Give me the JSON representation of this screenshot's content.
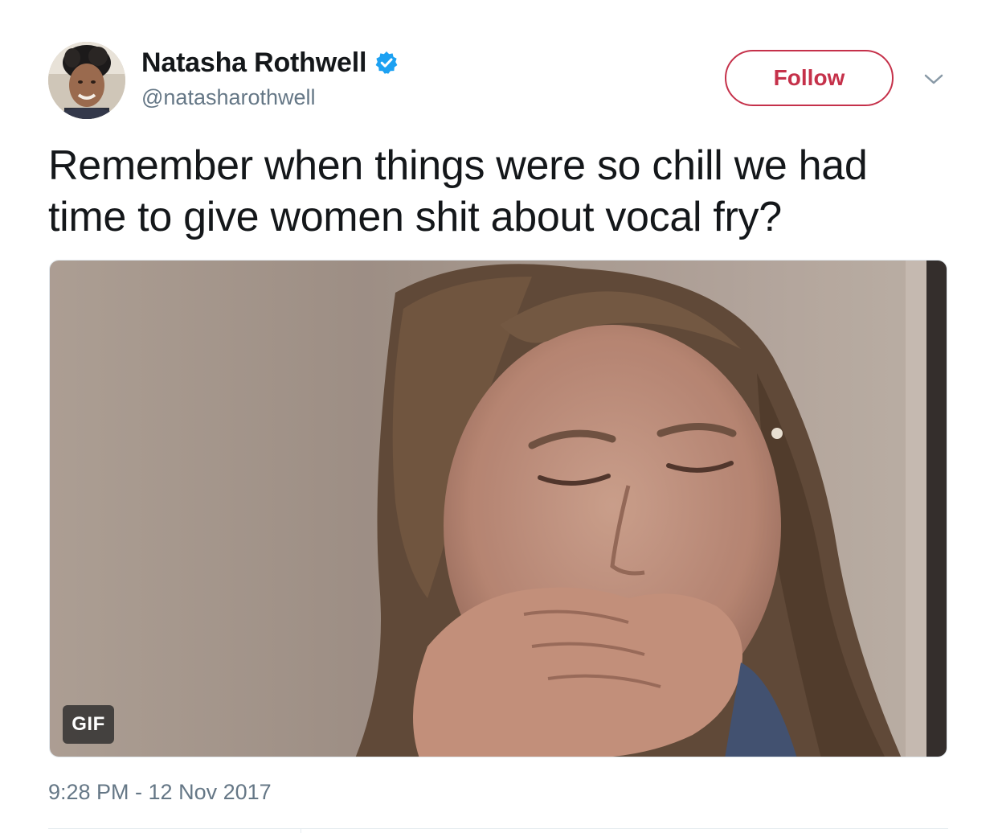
{
  "author": {
    "display_name": "Natasha Rothwell",
    "handle": "@natasharothwell",
    "verified": true,
    "avatar_icon": "profile-photo"
  },
  "actions": {
    "follow_label": "Follow",
    "menu_icon": "chevron-down-icon"
  },
  "tweet": {
    "text": "Remember when things were so chill we had time to give women shit about vocal fry?",
    "media_badge": "GIF",
    "timestamp": "9:28 PM - 12 Nov 2017"
  },
  "colors": {
    "follow_accent": "#c5314a",
    "verified_blue": "#1da1f2",
    "secondary_text": "#657786",
    "primary_text": "#14171a"
  }
}
